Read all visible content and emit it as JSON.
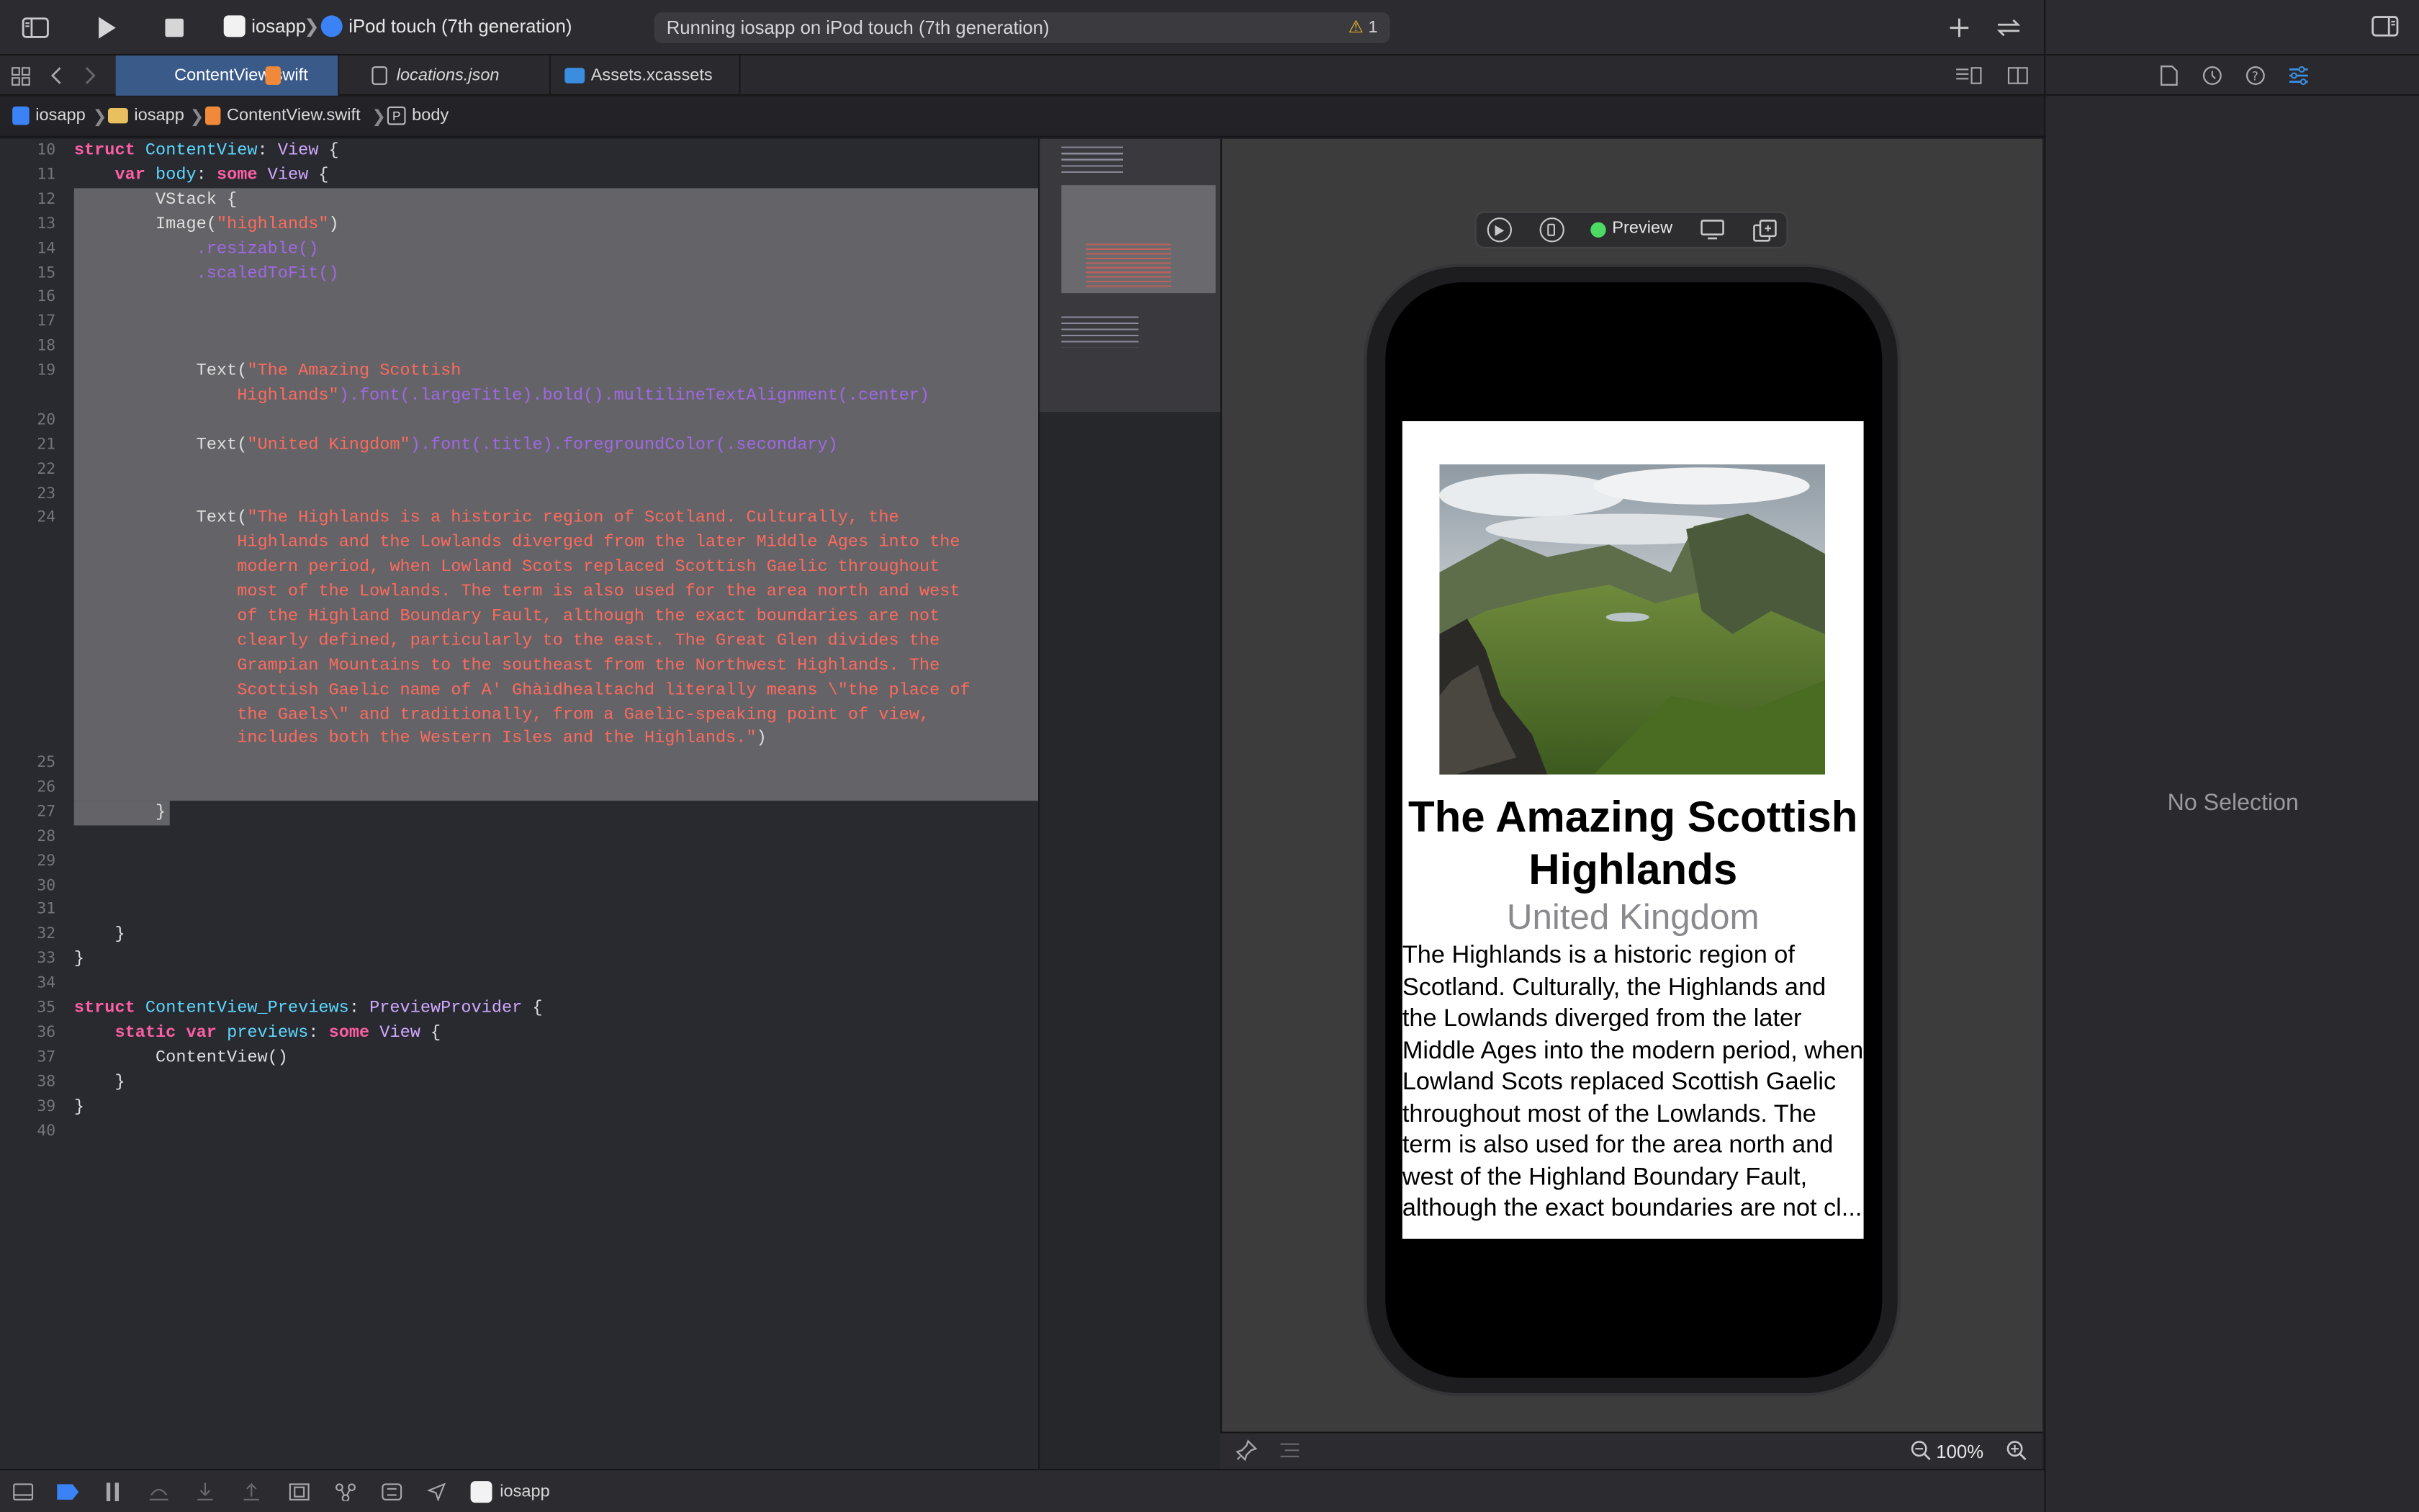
{
  "toolbar": {
    "scheme_name": "iosapp",
    "destination": "iPod touch (7th generation)",
    "status_text": "Running iosapp on iPod touch (7th generation)",
    "warning_count": "1",
    "icons": [
      "sidebar-toggle-icon",
      "play-icon",
      "stop-icon",
      "app-icon",
      "device-icon",
      "warning-icon",
      "plus-icon",
      "swap-icon",
      "inspector-toggle-icon"
    ]
  },
  "tabs": [
    {
      "label": "ContentView.swift",
      "active": true
    },
    {
      "label": "locations.json",
      "active": false
    },
    {
      "label": "Assets.xcassets",
      "active": false
    }
  ],
  "jumpbar": {
    "items": [
      "iosapp",
      "iosapp",
      "ContentView.swift",
      "body"
    ],
    "body_badge": "P"
  },
  "editor": {
    "line_numbers": [
      "10",
      "11",
      "12",
      "13",
      "14",
      "15",
      "16",
      "17",
      "18",
      "19",
      "",
      "20",
      "21",
      "22",
      "23",
      "24",
      "",
      "",
      "",
      "",
      "",
      "",
      "",
      "",
      "",
      "25",
      "26",
      "27",
      "28",
      "29",
      "30",
      "31",
      "32",
      "33",
      "34",
      "35",
      "36",
      "37",
      "38",
      "39",
      "40"
    ],
    "code": {
      "l10_struct": "struct",
      "l10_name": "ContentView",
      "l10_rest": ": ",
      "l10_type": "View",
      "l10_brace": " {",
      "l11_var": "var",
      "l11_body": "body",
      "l11_colon": ": ",
      "l11_some": "some",
      "l11_view": "View",
      "l11_brace": " {",
      "l12": "VStack {",
      "l13_a": "Image(",
      "l13_str": "\"highlands\"",
      "l13_b": ")",
      "l14": ".resizable()",
      "l15": ".scaledToFit()",
      "l19_a": "Text(",
      "l19_str": "\"The Amazing Scottish",
      "l19b_str": "Highlands\"",
      "l19b_rest": ").font(.largeTitle).bold().multilineTextAlignment(.center)",
      "l21_a": "Text(",
      "l21_str": "\"United Kingdom\"",
      "l21_rest": ").font(.title).foregroundColor(.secondary)",
      "l24_a": "Text(",
      "l24_lines": [
        "\"The Highlands is a historic region of Scotland. Culturally, the",
        "Highlands and the Lowlands diverged from the later Middle Ages into the",
        "modern period, when Lowland Scots replaced Scottish Gaelic throughout",
        "most of the Lowlands. The term is also used for the area north and west",
        "of the Highland Boundary Fault, although the exact boundaries are not",
        "clearly defined, particularly to the east. The Great Glen divides the",
        "Grampian Mountains to the southeast from the Northwest Highlands. The",
        "Scottish Gaelic name of A' Ghàidhealtachd literally means \\\"the place of",
        "the Gaels\\\" and traditionally, from a Gaelic-speaking point of view,",
        "includes both the Western Isles and the Highlands.\""
      ],
      "l24_end": ")",
      "l27": "}",
      "l32": "}",
      "l33": "}",
      "l35_struct": "struct",
      "l35_name": "ContentView_Previews",
      "l35_colon": ": ",
      "l35_proto": "PreviewProvider",
      "l35_brace": " {",
      "l36_static": "static",
      "l36_var": "var",
      "l36_previews": "previews",
      "l36_colon": ": ",
      "l36_some": "some",
      "l36_view": "View",
      "l36_brace": " {",
      "l37": "ContentView()",
      "l38": "}",
      "l39": "}"
    }
  },
  "preview": {
    "label": "Preview",
    "title": "The Amazing Scottish Highlands",
    "subtitle": "United Kingdom",
    "body": "The Highlands is a historic region of Scotland. Culturally, the Highlands and the Lowlands diverged from the later Middle Ages into the modern period, when Lowland Scots replaced Scottish Gaelic throughout most of the Lowlands. The term is also used for the area north and west of the Highland Boundary Fault, although the exact boundaries are not cl...",
    "zoom": "100%",
    "image_name": "highlands"
  },
  "inspector": {
    "empty_text": "No Selection"
  },
  "debugbar": {
    "target": "iosapp"
  },
  "colors": {
    "accent": "#3a5a8a",
    "keyword": "#fc5fa3",
    "type": "#5dd8ff",
    "string": "#fc6a5d",
    "function": "#a167e6",
    "live_dot": "#4cd964"
  }
}
